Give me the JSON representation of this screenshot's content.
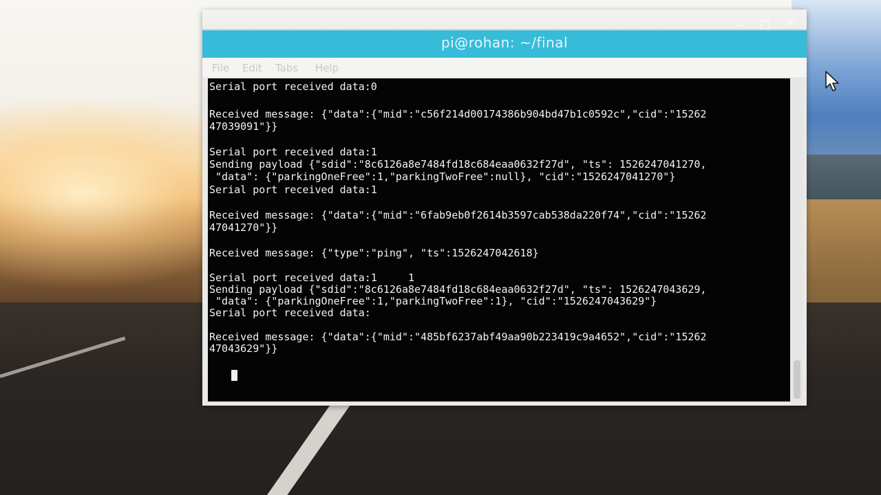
{
  "window": {
    "title": "pi@rohan: ~/final",
    "controls": {
      "minimize": "–",
      "maximize": "□",
      "close": "×"
    }
  },
  "menubar": {
    "items": [
      "File",
      "Edit",
      "Tabs",
      "Help"
    ]
  },
  "terminal": {
    "lines": [
      "Serial port received data:0",
      "",
      "Received message: {\"data\":{\"mid\":\"c56f214d00174386b904bd47b1c0592c\",\"cid\":\"15262",
      "47039091\"}}",
      "",
      "Serial port received data:1",
      "Sending payload {\"sdid\":\"8c6126a8e7484fd18c684eaa0632f27d\", \"ts\": 1526247041270,",
      " \"data\": {\"parkingOneFree\":1,\"parkingTwoFree\":null}, \"cid\":\"1526247041270\"}",
      "Serial port received data:1",
      "",
      "Received message: {\"data\":{\"mid\":\"6fab9eb0f2614b3597cab538da220f74\",\"cid\":\"15262",
      "47041270\"}}",
      "",
      "Received message: {\"type\":\"ping\", \"ts\":1526247042618}",
      "",
      "Serial port received data:1     1",
      "Sending payload {\"sdid\":\"8c6126a8e7484fd18c684eaa0632f27d\", \"ts\": 1526247043629,",
      " \"data\": {\"parkingOneFree\":1,\"parkingTwoFree\":1}, \"cid\":\"1526247043629\"}",
      "Serial port received data:",
      "",
      "Received message: {\"data\":{\"mid\":\"485bf6237abf49aa90b223419c9a4652\",\"cid\":\"15262",
      "47043629\"}}"
    ]
  },
  "colors": {
    "titlebar": "#36bcd9",
    "terminal_bg": "#040404",
    "terminal_fg": "#f2f2f2"
  },
  "icons": {
    "pointer": "mouse-pointer-icon"
  }
}
